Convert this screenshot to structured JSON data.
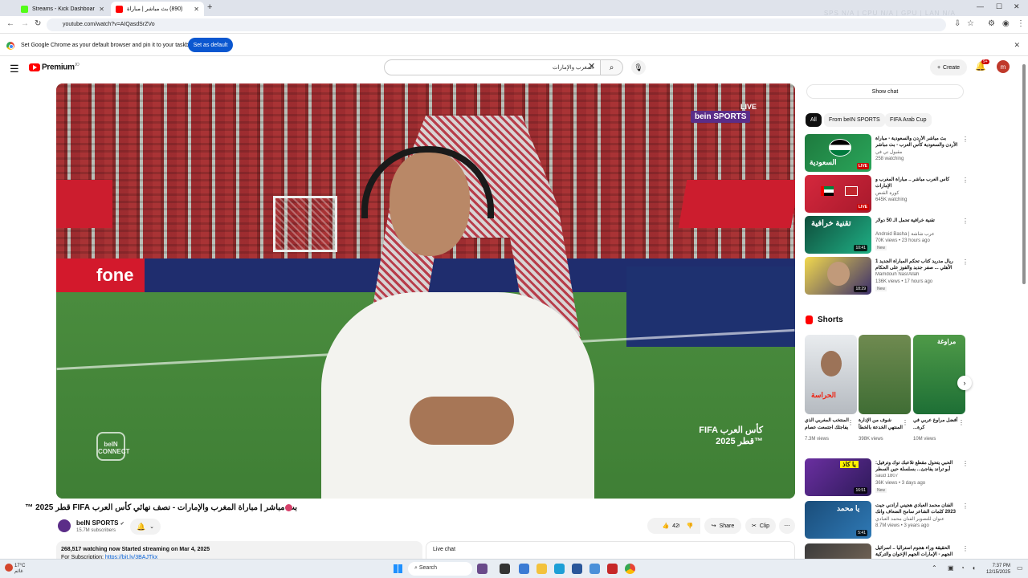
{
  "browser": {
    "tabs": [
      {
        "title": "Streams - Kick Dashboard",
        "active": false
      },
      {
        "title": "(890) بث مباشر | مباراة",
        "active": true
      }
    ],
    "url": "youtube.com/watch?v=AIQasdSrZVo",
    "background_tab_text": "SPS N/A | CPU N/A | GPU | LAN N/A",
    "infobar_text": "Set Google Chrome as your default browser and pin it to your taskbar",
    "infobar_button": "Set as default"
  },
  "header": {
    "brand": "Premium",
    "brand_sup": "JO",
    "search_value": "المغرب والإمارات",
    "create_label": "Create",
    "notification_count": "9+",
    "avatar_letter": "m"
  },
  "video": {
    "live_label": "LIVE",
    "broadcaster_mark": "bein SPORTS",
    "connect_mark": "beIN CONNECT",
    "fifa_mark": "FIFA كأس العرب",
    "fifa_mark_2": "قطر 2025™",
    "ad_left": "fone",
    "title": "بث مباشر | مباراة المغرب والإمارات - نصف نهائي كأس العرب FIFA قطر 2025 ™",
    "channel_name": "beIN SPORTS",
    "subscribers": "15.7M subscribers",
    "likes": "420K",
    "share_label": "Share",
    "clip_label": "Clip",
    "watching_line": "268,517 watching now  Started streaming on Mar 4, 2025",
    "subscription_prefix": "For Subscription: ",
    "subscription_link": "https://bit.ly/3BAJTkx",
    "live_chat_label": "Live chat"
  },
  "sidebar": {
    "show_chat": "Show chat",
    "chips": [
      "All",
      "From beIN SPORTS",
      "FIFA Arab Cup"
    ],
    "recommendations": [
      {
        "title": "بث مباشر الأردن والسعودية - مباراة الأردن والسعودية كأس العرب - بث مباشر",
        "channel": "مقبول تي في",
        "meta": "258 watching",
        "badge": "LIVE",
        "thumb_text": "السعودية",
        "new": ""
      },
      {
        "title": "كأس العرب مباشر .. مباراة المغرب و الإمارات",
        "channel": "كورة القنص",
        "meta": "645K watching",
        "badge": "LIVE",
        "thumb_text": "",
        "new": ""
      },
      {
        "title": "تقنية خرافية تحمل الـ 50 دولار",
        "channel": "Android Basha | عرب شاشة",
        "meta": "70K views • 23 hours ago",
        "badge": "10:41",
        "thumb_text": "تقنية خرافية",
        "new": "New"
      },
      {
        "title": "ريال مدريد كتاب تحكم المباراة الجديد 1 الأهلي ... صفر جديد والفوز على الحكام الأوحد يوسف",
        "channel": "Mamdouh NasrAllah",
        "meta": "136K views • 17 hours ago",
        "badge": "18:29",
        "thumb_text": "",
        "new": "New"
      },
      {
        "title": "الحبي يتحول مقطع تلاعبك توك وترفيل: أبو تراند يفاجئ... بسلسلة حين السطر",
        "channel": "saud 1807",
        "meta": "36K views • 3 days ago",
        "badge": "16:51",
        "thumb_text": "يا كاذ",
        "new": "New"
      },
      {
        "title": "الفنان محمد العبادي هجيني أرادني جيت 2023 كلمات الشاعر سامح الضعاف وانك",
        "channel": "عنوان للتصوير الفنان محمد العبادي",
        "meta": "8.7M views • 3 years ago",
        "badge": "5:41",
        "thumb_text": "يا محمد",
        "new": ""
      },
      {
        "title": "الحقيقة وراء هجوم استراليا .. اسرائيل الجهم - الإمارات الجهم الإخوان والتركية الإيد...",
        "channel": "",
        "meta": "",
        "badge": "",
        "thumb_text": "",
        "new": ""
      }
    ],
    "shorts_title": "Shorts",
    "shorts": [
      {
        "caption": "المنتخب المغربي الذي يفاجئك اجتمعت عصام",
        "views": "7.3M views",
        "thumb_text": "الحراسة"
      },
      {
        "caption": "شوف من الإدارة المنتهي الخدعة بالخطأ",
        "views": "398K views",
        "thumb_text": ""
      },
      {
        "caption": "أفضل مراوغ عربي في كرة...",
        "views": "10M views",
        "thumb_text": "مراوغة"
      }
    ]
  },
  "taskbar": {
    "weather_temp": "17°C",
    "weather_desc": "غائم",
    "search": "Search",
    "time": "7:37 PM",
    "date": "12/15/2025"
  },
  "colors": {
    "youtube_red": "#ff0000",
    "link_blue": "#065fd4",
    "chrome_blue_button": "#0b57d0",
    "bein_purple": "#5b2d88"
  }
}
